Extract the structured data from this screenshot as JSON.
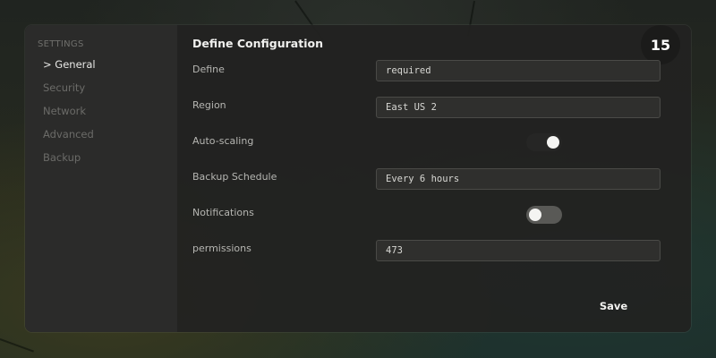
{
  "sidebar": {
    "title": "SETTINGS",
    "items": [
      {
        "label": "> General",
        "active": true
      },
      {
        "label": "Security",
        "active": false
      },
      {
        "label": "Network",
        "active": false
      },
      {
        "label": "Advanced",
        "active": false
      },
      {
        "label": "Backup",
        "active": false
      }
    ]
  },
  "main": {
    "title": "Define Configuration",
    "step_badge": "15",
    "fields": {
      "define": {
        "label": "Define",
        "value": "required"
      },
      "region": {
        "label": "Region",
        "value": "East US 2"
      },
      "autoscaling": {
        "label": "Auto-scaling",
        "toggle": "on"
      },
      "backup_schedule": {
        "label": "Backup Schedule",
        "value": "Every 6 hours"
      },
      "notifications": {
        "label": "Notifications",
        "toggle": "off"
      },
      "permissions": {
        "label": "permissions",
        "value": "473"
      }
    },
    "save_label": "Save"
  },
  "colors": {
    "window_bg": "#222221",
    "sidebar_bg": "#2c2c2b",
    "input_bg": "#2f2f2d",
    "toggle_on": "#262625",
    "toggle_off": "#595956",
    "text_primary": "#f0f0ee",
    "text_muted": "#6b6b68"
  }
}
